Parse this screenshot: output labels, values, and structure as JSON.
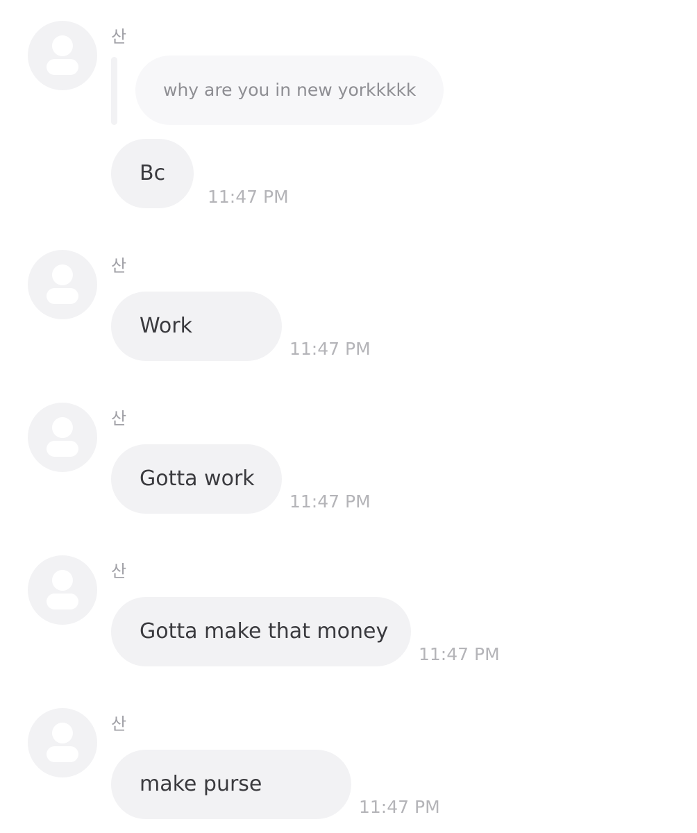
{
  "messages": [
    {
      "sender": "산",
      "quote": "why are you in new yorkkkkk",
      "text": "Bc",
      "time": "11:47 PM"
    },
    {
      "sender": "산",
      "text": "Work",
      "time": "11:47 PM"
    },
    {
      "sender": "산",
      "text": "Gotta work",
      "time": "11:47 PM"
    },
    {
      "sender": "산",
      "text": "Gotta make that money",
      "time": "11:47 PM"
    },
    {
      "sender": "산",
      "text": "make purse",
      "time": "11:47 PM"
    }
  ],
  "colors": {
    "bubble": "#f2f2f4",
    "quote_bubble": "#f7f7f9",
    "text": "#3a3a3e",
    "quote_text": "#8e8e93",
    "timestamp": "#b4b4b8",
    "sender": "#a0a0a6"
  },
  "icons": {
    "avatar": "default-user-avatar-icon"
  }
}
